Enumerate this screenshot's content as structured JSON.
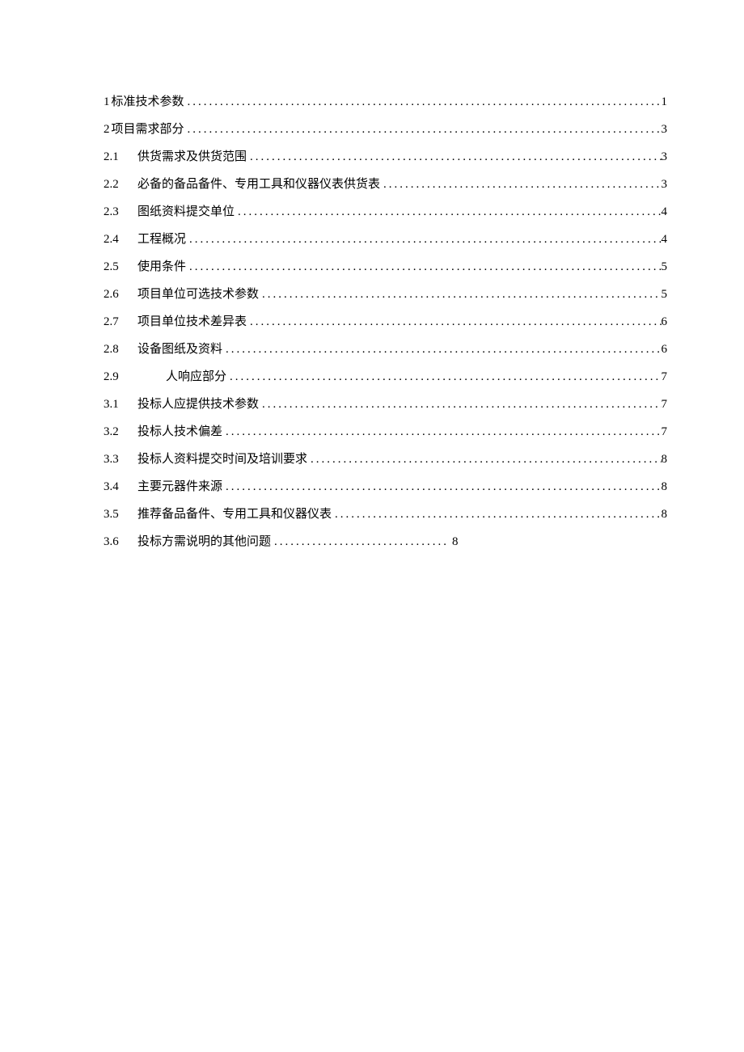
{
  "toc": {
    "entries": [
      {
        "kind": "top",
        "num": "1",
        "title": "标准技术参数",
        "page": "1",
        "full": true,
        "indent": false
      },
      {
        "kind": "top",
        "num": "2",
        "title": "项目需求部分",
        "page": "3",
        "full": true,
        "indent": false
      },
      {
        "kind": "sub",
        "num": "2.1",
        "title": "供货需求及供货范围",
        "page": "3",
        "full": true,
        "indent": false
      },
      {
        "kind": "sub",
        "num": "2.2",
        "title": "必备的备品备件、专用工具和仪器仪表供货表",
        "page": "3",
        "full": true,
        "indent": false
      },
      {
        "kind": "sub",
        "num": "2.3",
        "title": "图纸资料提交单位",
        "page": "4",
        "full": true,
        "indent": false
      },
      {
        "kind": "sub",
        "num": "2.4",
        "title": "工程概况",
        "page": "4",
        "full": true,
        "indent": false
      },
      {
        "kind": "sub",
        "num": "2.5",
        "title": "使用条件",
        "page": "5",
        "full": true,
        "indent": false
      },
      {
        "kind": "sub",
        "num": "2.6",
        "title": "项目单位可选技术参数",
        "page": "5",
        "full": true,
        "indent": false
      },
      {
        "kind": "sub",
        "num": "2.7",
        "title": "项目单位技术差异表",
        "page": "6",
        "full": true,
        "indent": false
      },
      {
        "kind": "sub",
        "num": "2.8",
        "title": "设备图纸及资料",
        "page": "6",
        "full": true,
        "indent": false
      },
      {
        "kind": "sub",
        "num": "2.9",
        "title": "人响应部分",
        "page": "7",
        "full": true,
        "indent": true
      },
      {
        "kind": "sub",
        "num": "3.1",
        "title": "投标人应提供技术参数",
        "page": "7",
        "full": true,
        "indent": false
      },
      {
        "kind": "sub",
        "num": "3.2",
        "title": "投标人技术偏差",
        "page": "7",
        "full": true,
        "indent": false
      },
      {
        "kind": "sub",
        "num": "3.3",
        "title": "投标人资料提交时间及培训要求",
        "page": "8",
        "full": true,
        "indent": false
      },
      {
        "kind": "sub",
        "num": "3.4",
        "title": "主要元器件来源",
        "page": "8",
        "full": true,
        "indent": false
      },
      {
        "kind": "sub",
        "num": "3.5",
        "title": "推荐备品备件、专用工具和仪器仪表",
        "page": "8",
        "full": true,
        "indent": false
      },
      {
        "kind": "sub",
        "num": "3.6",
        "title": "投标方需说明的其他问题",
        "page": "8",
        "full": false,
        "indent": false
      }
    ]
  }
}
